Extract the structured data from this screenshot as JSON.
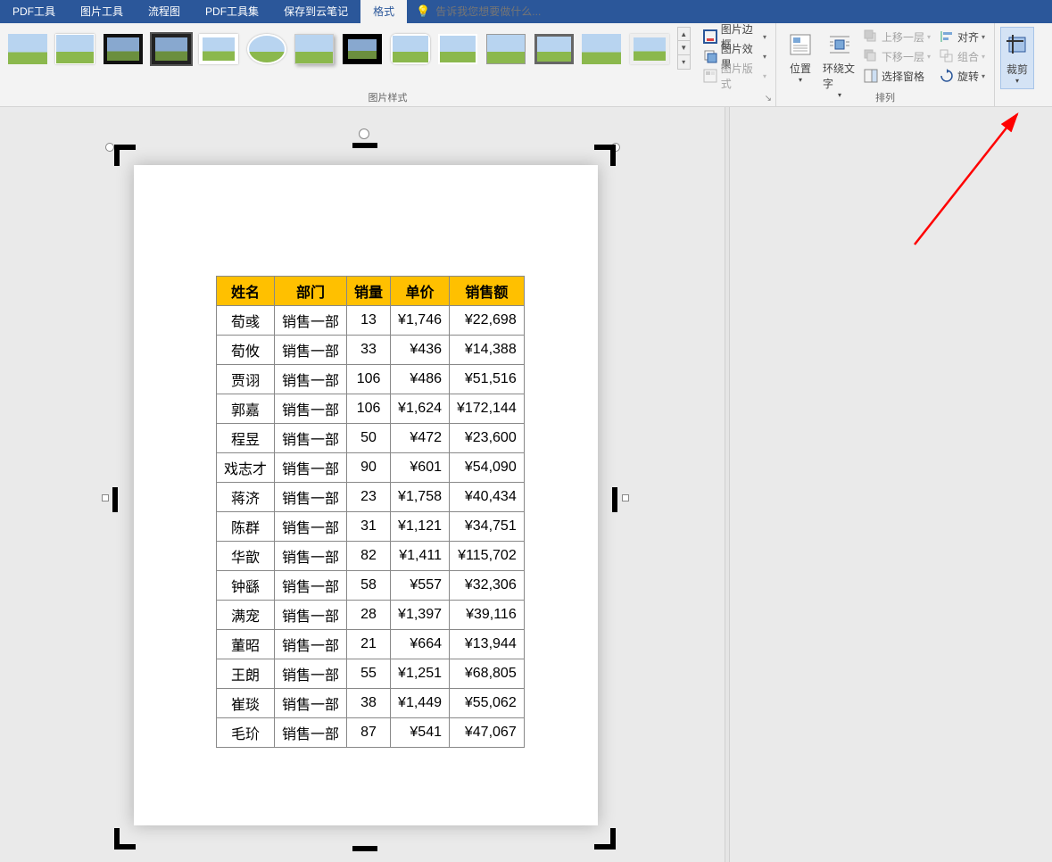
{
  "menu": {
    "tabs": [
      "PDF工具",
      "图片工具",
      "流程图",
      "PDF工具集",
      "保存到云笔记",
      "格式"
    ],
    "active": "格式",
    "tell_me_placeholder": "告诉我您想要做什么..."
  },
  "ribbon": {
    "styles_group_label": "图片样式",
    "picture_border": "图片边框",
    "picture_effects": "图片效果",
    "picture_layout": "图片版式",
    "position": "位置",
    "wrap_text": "环绕文字",
    "bring_forward": "上移一层",
    "send_backward": "下移一层",
    "selection_pane": "选择窗格",
    "align": "对齐",
    "group": "组合",
    "rotate": "旋转",
    "arrange_label": "排列",
    "crop": "裁剪"
  },
  "table": {
    "headers": [
      "姓名",
      "部门",
      "销量",
      "单价",
      "销售额"
    ],
    "rows": [
      [
        "荀彧",
        "销售一部",
        "13",
        "¥1,746",
        "¥22,698"
      ],
      [
        "荀攸",
        "销售一部",
        "33",
        "¥436",
        "¥14,388"
      ],
      [
        "贾诩",
        "销售一部",
        "106",
        "¥486",
        "¥51,516"
      ],
      [
        "郭嘉",
        "销售一部",
        "106",
        "¥1,624",
        "¥172,144"
      ],
      [
        "程昱",
        "销售一部",
        "50",
        "¥472",
        "¥23,600"
      ],
      [
        "戏志才",
        "销售一部",
        "90",
        "¥601",
        "¥54,090"
      ],
      [
        "蒋济",
        "销售一部",
        "23",
        "¥1,758",
        "¥40,434"
      ],
      [
        "陈群",
        "销售一部",
        "31",
        "¥1,121",
        "¥34,751"
      ],
      [
        "华歆",
        "销售一部",
        "82",
        "¥1,411",
        "¥115,702"
      ],
      [
        "钟繇",
        "销售一部",
        "58",
        "¥557",
        "¥32,306"
      ],
      [
        "满宠",
        "销售一部",
        "28",
        "¥1,397",
        "¥39,116"
      ],
      [
        "董昭",
        "销售一部",
        "21",
        "¥664",
        "¥13,944"
      ],
      [
        "王朗",
        "销售一部",
        "55",
        "¥1,251",
        "¥68,805"
      ],
      [
        "崔琰",
        "销售一部",
        "38",
        "¥1,449",
        "¥55,062"
      ],
      [
        "毛玠",
        "销售一部",
        "87",
        "¥541",
        "¥47,067"
      ]
    ]
  }
}
